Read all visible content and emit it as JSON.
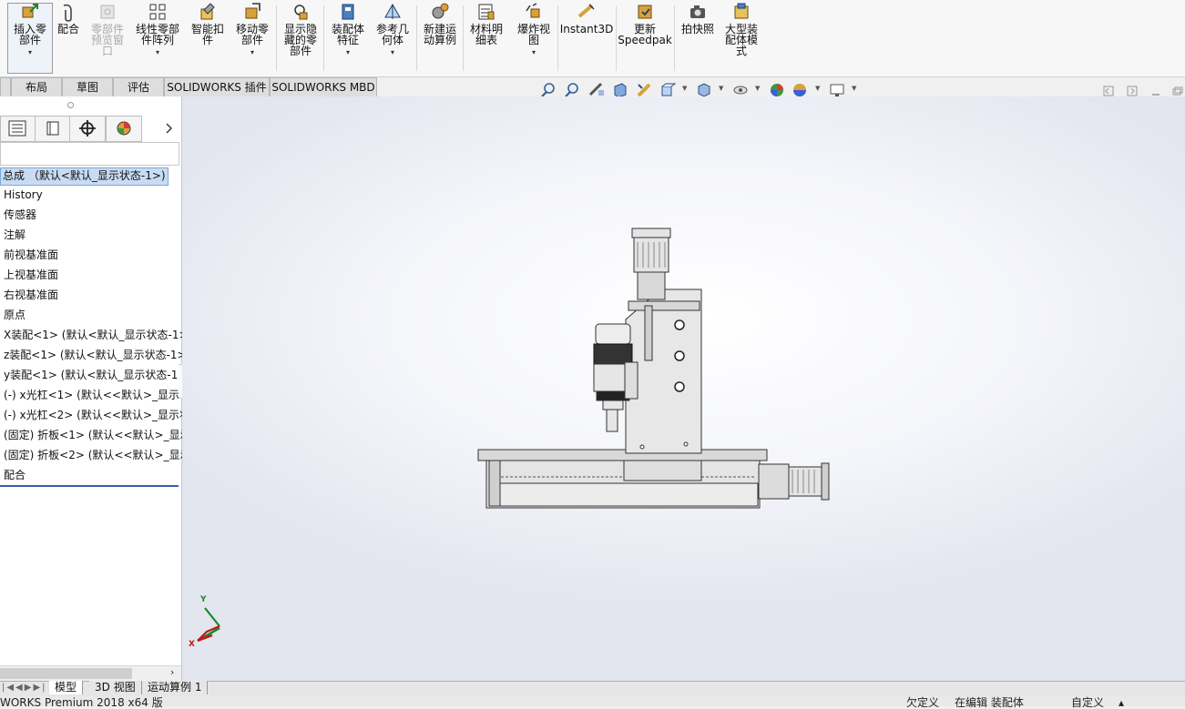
{
  "ribbon": {
    "buttons": [
      {
        "key": "insert",
        "label": "插入零\n部件",
        "dropdown": true
      },
      {
        "key": "mate",
        "label": "配合"
      },
      {
        "key": "preview",
        "label": "零部件\n预览窗\n口",
        "disabled": true
      },
      {
        "key": "linear",
        "label": "线性零部\n件阵列",
        "dropdown": true
      },
      {
        "key": "smart",
        "label": "智能扣\n件"
      },
      {
        "key": "move",
        "label": "移动零\n部件",
        "dropdown": true
      },
      {
        "key": "showhide",
        "label": "显示隐\n藏的零\n部件"
      },
      {
        "key": "asmfeat",
        "label": "装配体\n特征",
        "dropdown": true
      },
      {
        "key": "refgeo",
        "label": "参考几\n何体",
        "dropdown": true
      },
      {
        "key": "motion",
        "label": "新建运\n动算例"
      },
      {
        "key": "bom",
        "label": "材料明\n细表"
      },
      {
        "key": "explode",
        "label": "爆炸视\n图",
        "dropdown": true
      },
      {
        "key": "instant3d",
        "label": "Instant3D"
      },
      {
        "key": "speedpak",
        "label": "更新\nSpeedpak"
      },
      {
        "key": "snapshot",
        "label": "拍快照"
      },
      {
        "key": "largeasm",
        "label": "大型装\n配体模\n式"
      }
    ]
  },
  "command_tabs": [
    "布局",
    "草图",
    "评估",
    "SOLIDWORKS 插件",
    "SOLIDWORKS MBD"
  ],
  "hud_icons": [
    "zoom-to-fit-icon",
    "zoom-area-icon",
    "previous-view-icon",
    "section-view-icon",
    "dynamic-annotation-icon",
    "view-orientation-icon",
    "display-style-icon",
    "hide-show-icon",
    "edit-appearance-icon",
    "apply-scene-icon",
    "view-settings-icon"
  ],
  "tree": {
    "root": "总成 （默认<默认_显示状态-1>)",
    "items": [
      "History",
      "传感器",
      "注解",
      "前视基准面",
      "上视基准面",
      "右视基准面",
      "原点",
      "X装配<1> (默认<默认_显示状态-1>",
      "z装配<1> (默认<默认_显示状态-1>",
      "y装配<1> (默认<默认_显示状态-1>",
      "(-) x光杠<1> (默认<<默认>_显示状",
      "(-) x光杠<2> (默认<<默认>_显示状",
      "(固定) 折板<1> (默认<<默认>_显示",
      "(固定) 折板<2> (默认<<默认>_显示",
      "配合"
    ]
  },
  "triad": {
    "x": "X",
    "y": "Y"
  },
  "bottom_tabs": [
    "模型",
    "3D 视图",
    "运动算例 1"
  ],
  "status": {
    "product": "WORKS Premium 2018 x64 版",
    "defined": "欠定义",
    "editing": "在编辑 装配体",
    "units": "自定义"
  },
  "colors": {
    "accent": "#3a5fa8",
    "selection": "#c7dcf3",
    "x_axis": "#c01818",
    "y_axis": "#168a2c"
  }
}
